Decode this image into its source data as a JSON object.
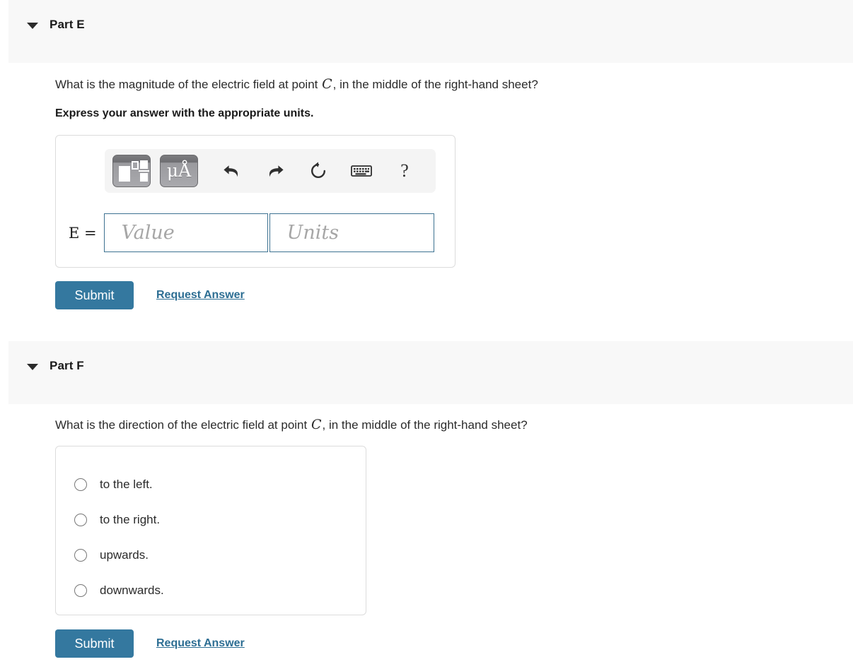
{
  "colors": {
    "accent": "#34789f",
    "link": "#2d6e93",
    "header_bg": "#f8f8f8",
    "box_border": "#dcdcdc",
    "input_border": "#3d7291",
    "text": "#2b2b2b"
  },
  "part_e": {
    "title": "Part E",
    "caret_icon": "caret-down-icon",
    "question_before": "What is the magnitude of the electric field at point ",
    "question_var": "C",
    "question_after": ", in the middle of the right-hand sheet?",
    "instruction": "Express your answer with the appropriate units.",
    "toolbar": {
      "buttons": [
        {
          "name": "template-icon",
          "label": ""
        },
        {
          "name": "units-icon",
          "label": "μÅ"
        }
      ],
      "icons": [
        {
          "name": "undo-icon",
          "title": "Undo"
        },
        {
          "name": "redo-icon",
          "title": "Redo"
        },
        {
          "name": "reset-icon",
          "title": "Reset"
        },
        {
          "name": "keyboard-icon",
          "title": "Keyboard shortcuts"
        },
        {
          "name": "help-icon",
          "title": "Help",
          "label": "?"
        }
      ]
    },
    "equation_label": "E =",
    "value_input": {
      "value": "",
      "placeholder": "Value"
    },
    "units_input": {
      "value": "",
      "placeholder": "Units"
    },
    "submit_label": "Submit",
    "request_answer_label": "Request Answer"
  },
  "part_f": {
    "title": "Part F",
    "caret_icon": "caret-down-icon",
    "question_before": "What is the direction of the electric field at point ",
    "question_var": "C",
    "question_after": ", in the middle of the right-hand sheet?",
    "options": [
      {
        "label": "to the left.",
        "selected": false
      },
      {
        "label": "to the right.",
        "selected": false
      },
      {
        "label": "upwards.",
        "selected": false
      },
      {
        "label": "downwards.",
        "selected": false
      }
    ],
    "submit_label": "Submit",
    "request_answer_label": "Request Answer"
  }
}
